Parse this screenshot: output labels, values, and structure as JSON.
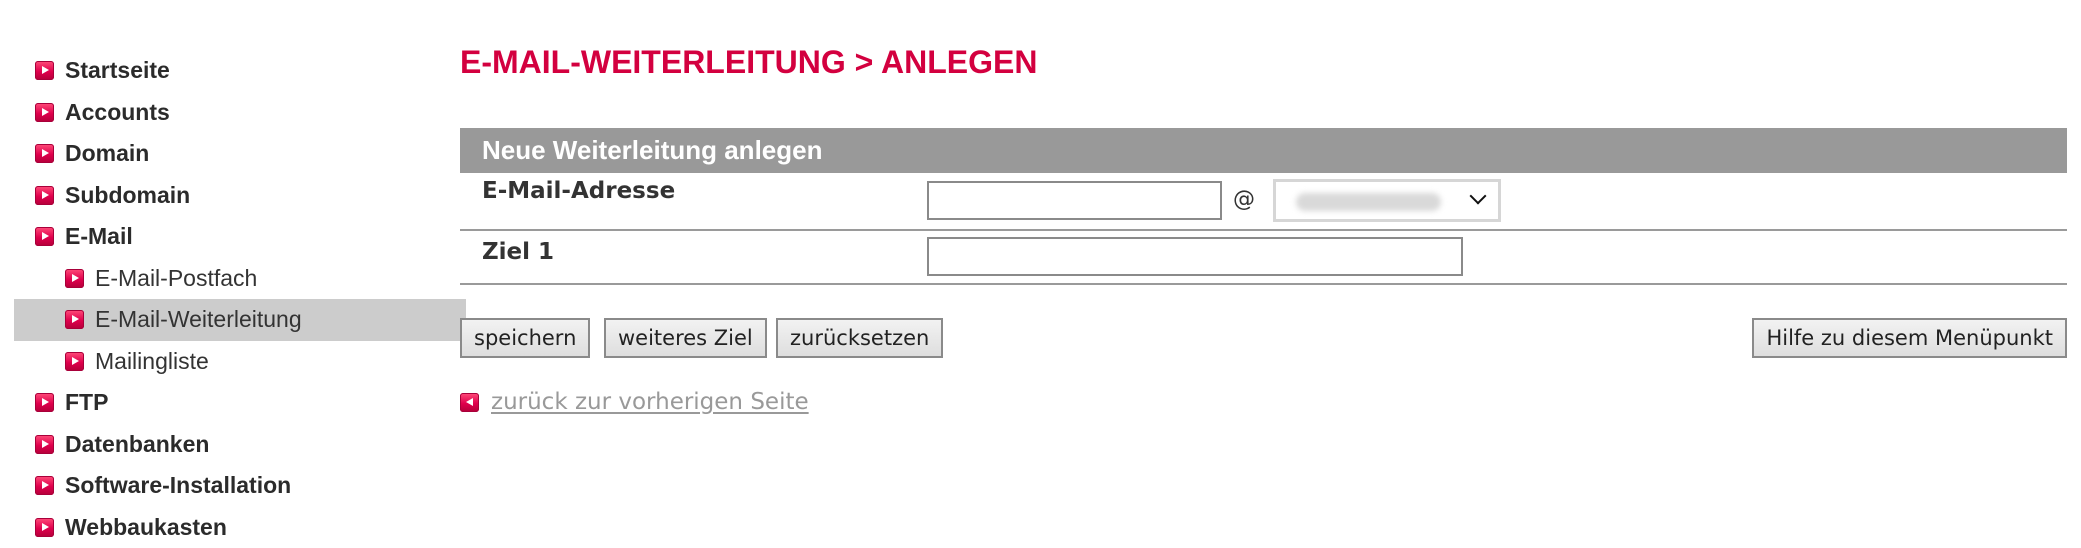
{
  "sidebar": {
    "items": [
      {
        "label": "Startseite"
      },
      {
        "label": "Accounts"
      },
      {
        "label": "Domain"
      },
      {
        "label": "Subdomain"
      },
      {
        "label": "E-Mail"
      },
      {
        "label": "E-Mail-Postfach"
      },
      {
        "label": "E-Mail-Weiterleitung"
      },
      {
        "label": "Mailingliste"
      },
      {
        "label": "FTP"
      },
      {
        "label": "Datenbanken"
      },
      {
        "label": "Software-Installation"
      },
      {
        "label": "Webbaukasten"
      }
    ]
  },
  "page": {
    "title": "E-MAIL-WEITERLEITUNG > ANLEGEN"
  },
  "form": {
    "header": "Neue Weiterleitung anlegen",
    "email_label": "E-Mail-Adresse",
    "email_value": "",
    "at_sign": "@",
    "domain_select_value": "",
    "target_label": "Ziel 1",
    "target_value": ""
  },
  "buttons": {
    "save": "speichern",
    "more_target": "weiteres Ziel",
    "reset": "zurücksetzen",
    "help": "Hilfe zu diesem Menüpunkt"
  },
  "back_link": "zurück zur vorherigen Seite",
  "colors": {
    "accent": "#d3003f",
    "form_header_bg": "#999999",
    "active_nav_bg": "#cccccc",
    "link": "#999999"
  },
  "icons": {
    "nav_bullet": "arrow-right-bullet-icon",
    "back_bullet": "arrow-left-bullet-icon",
    "select": "chevron-down-icon"
  }
}
